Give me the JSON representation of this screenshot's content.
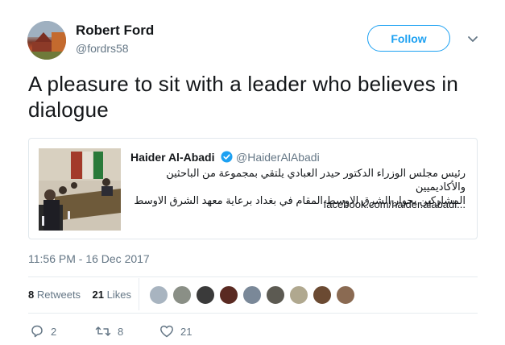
{
  "author": {
    "name": "Robert Ford",
    "handle": "@fordrs58"
  },
  "follow_label": "Follow",
  "tweet_text": "A pleasure to sit with a leader who believes in dialogue",
  "quoted": {
    "name": "Haider Al-Abadi",
    "handle": "@HaiderAlAbadi",
    "text_line1": "رئيس مجلس الوزراء الدكتور حيدر العبادي يلتقي بمجموعة من الباحثين والأكاديميين",
    "text_line2": "المشاركين بحوار الشرق الاوسط المقام في بغداد برعاية معهد الشرق الاوسط",
    "link": "facebook.com/haider.alabadi..."
  },
  "timestamp": "11:56 PM - 16 Dec 2017",
  "stats": {
    "retweets_count": "8",
    "retweets_label": "Retweets",
    "likes_count": "21",
    "likes_label": "Likes"
  },
  "actions": {
    "replies": "2",
    "retweets": "8",
    "likes": "21"
  },
  "colors": {
    "accent": "#1da1f2",
    "secondary_text": "#657786",
    "border": "#e1e8ed"
  }
}
